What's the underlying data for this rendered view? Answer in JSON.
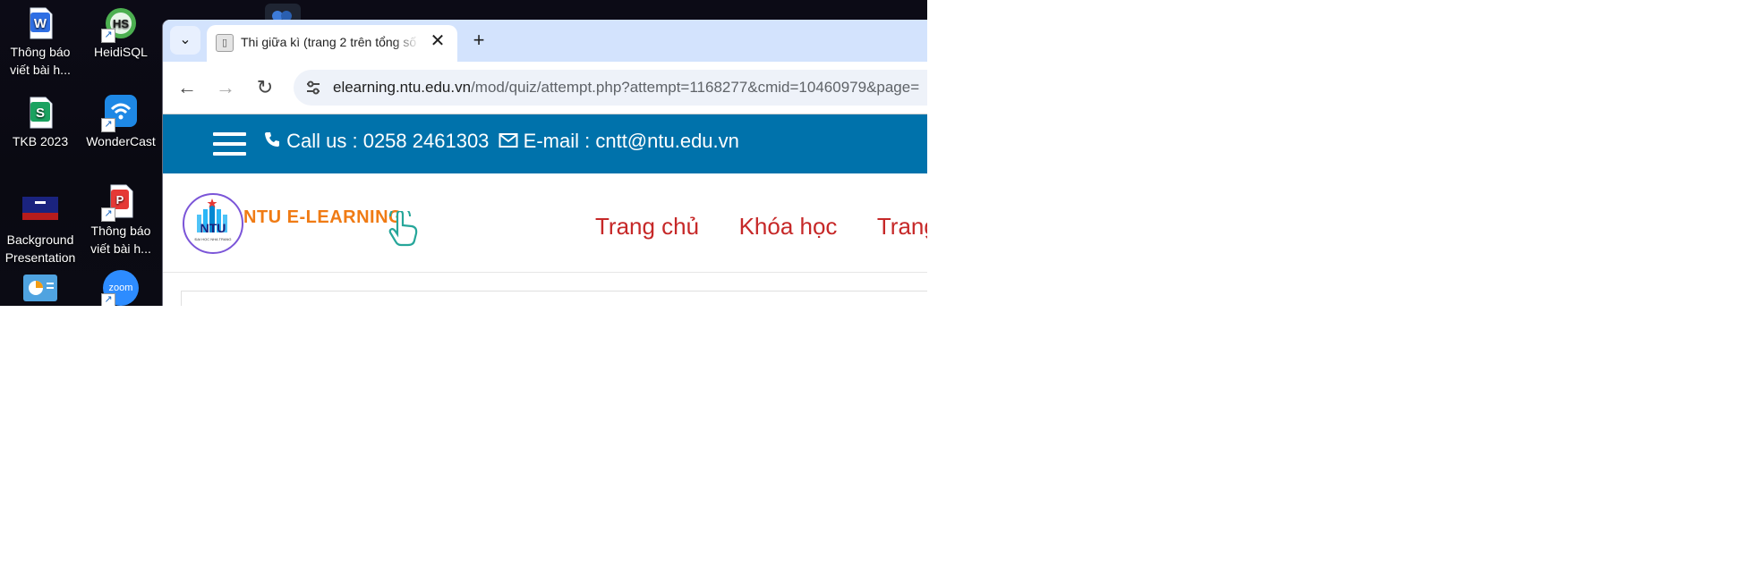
{
  "desktop": {
    "icons": [
      {
        "label": "Thông báo viết bài h...",
        "icon": "word-doc-icon",
        "color": "#2f6fe4"
      },
      {
        "label": "HeidiSQL",
        "icon": "heidisql-icon",
        "color": "#4caf50"
      },
      {
        "label": "TKB 2023",
        "icon": "spreadsheet-icon",
        "color": "#1aa260"
      },
      {
        "label": "WonderCast",
        "icon": "wondercast-icon",
        "color": "#1e88e5"
      },
      {
        "label": "Background Presentation",
        "icon": "presentation-thumbnail-icon",
        "color": "#1a237e"
      },
      {
        "label": "Thông báo viết bài h...",
        "icon": "pdf-doc-icon",
        "color": "#e53935"
      },
      {
        "label": "",
        "icon": "chart-app-icon",
        "color": "#4fa3e0"
      },
      {
        "label": "",
        "icon": "zoom-icon",
        "color": "#2d8cff"
      }
    ],
    "zoom_text": "zoom"
  },
  "browser": {
    "tab_title": "Thi giữa kì (trang 2 trên tổng số",
    "tab_close": "✕",
    "new_tab": "+",
    "tab_search": "⌄",
    "back": "←",
    "forward": "→",
    "reload": "↻",
    "url_host": "elearning.ntu.edu.vn",
    "url_path": "/mod/quiz/attempt.php?attempt=1168277&cmid=10460979&page="
  },
  "page": {
    "contact": {
      "call_label": "Call us : 0258 2461303",
      "email_label": "E-mail : cntt@ntu.edu.vn"
    },
    "logo": {
      "text": "NTU E-LEARNING",
      "badge_text": "NTU",
      "badge_subtext": "ĐẠI HỌC NHA TRANG"
    },
    "nav": [
      "Trang chủ",
      "Khóa học",
      "Trang"
    ],
    "colors": {
      "topbar": "#0072ab",
      "nav_link": "#c62828",
      "logo_text": "#f07b14",
      "tab_strip": "#d3e3fd"
    }
  }
}
